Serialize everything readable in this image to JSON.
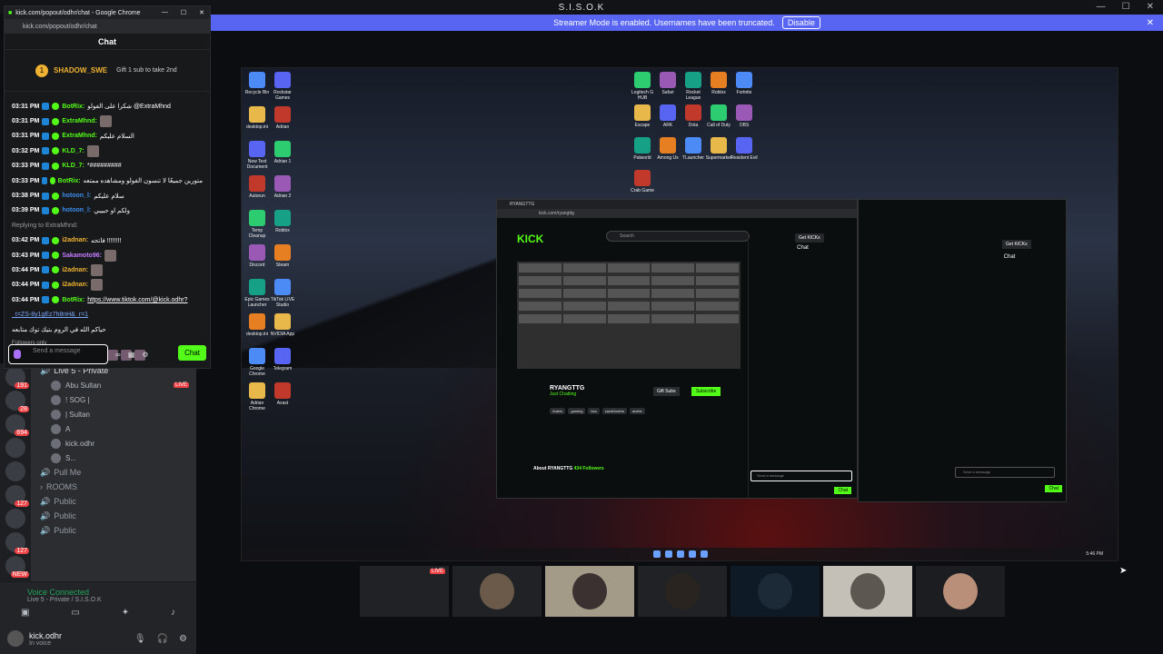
{
  "window": {
    "title": "S.I.S.O.K"
  },
  "banner": {
    "text": "Streamer Mode is enabled. Usernames have been truncated.",
    "button": "Disable"
  },
  "popout": {
    "title": "kick.com/popout/odhr/chat - Google Chrome",
    "url": "kick.com/popout/odhr/chat",
    "header": "Chat",
    "pinned_name": "SHADOW_SWE",
    "pinned_count": "1",
    "gift_text": "Gift 1 sub to take 2nd",
    "messages": [
      {
        "time": "03:31 PM",
        "user": "BotRix:",
        "color": "#53fc18",
        "text": "شكرا على الفولو @ExtraMhnd"
      },
      {
        "time": "03:31 PM",
        "user": "ExtraMhnd:",
        "color": "#53fc18",
        "text": ""
      },
      {
        "time": "03:31 PM",
        "user": "ExtraMhnd:",
        "color": "#53fc18",
        "text": "السلام عليكم"
      },
      {
        "time": "03:32 PM",
        "user": "KLD_7:",
        "color": "#53fc18",
        "text": ""
      },
      {
        "time": "03:33 PM",
        "user": "KLD_7:",
        "color": "#53fc18",
        "text": "*#########"
      },
      {
        "time": "03:33 PM",
        "user": "BotRix:",
        "color": "#53fc18",
        "text": "متورين جميعًا لا تنسون الفولو ومشاهده ممتعه"
      },
      {
        "time": "03:38 PM",
        "user": "hotoon_l:",
        "color": "#3b8eea",
        "text": "سلام عليكم"
      },
      {
        "time": "03:39 PM",
        "user": "hotoon_l:",
        "color": "#3b8eea",
        "text": "ولكم او حبيبي"
      },
      {
        "time": "03:42 PM",
        "user": "i2adnan:",
        "color": "#f0b232",
        "text": "فاتحه !!!!!!!!"
      },
      {
        "time": "03:43 PM",
        "user": "Sakamoto96:",
        "color": "#c27cff",
        "text": ""
      },
      {
        "time": "03:44 PM",
        "user": "i2adnan:",
        "color": "#f0b232",
        "text": ""
      },
      {
        "time": "03:44 PM",
        "user": "i2adnan:",
        "color": "#f0b232",
        "text": ""
      },
      {
        "time": "03:44 PM",
        "user": "BotRix:",
        "color": "#53fc18",
        "text": "https://www.tiktok.com/@kick.odhr?"
      }
    ],
    "reply_text": "Replying to ExtraMhnd:",
    "link_cont": "_t=ZS-8y1gEz7h8nH&_r=1",
    "link_note": "حياكم الله في الروم بتيك توك متابعه",
    "followers_only": "Followers only",
    "input_placeholder": "Send a message",
    "chat_button": "Chat"
  },
  "discord": {
    "channel_live": "Live 5 - Private",
    "users": [
      {
        "name": "Abu Sultan",
        "live": "LIVE"
      },
      {
        "name": "! SOG |"
      },
      {
        "name": "| Sultan"
      },
      {
        "name": "A"
      },
      {
        "name": "kick.odhr"
      },
      {
        "name": "S..."
      }
    ],
    "pull_me": "Pull Me",
    "rooms": "ROOMS",
    "publics": [
      "Public",
      "Public",
      "Public"
    ],
    "voice_connected": "Voice Connected",
    "voice_sub": "Live 5 - Private / S.I.S.O.K",
    "username": "kick.odhr",
    "status": "In voice",
    "badges": [
      "191",
      "28",
      "694",
      "127",
      "127",
      "NEW"
    ]
  },
  "browser": {
    "kick_logo": "KICK",
    "search": "Search",
    "get_kicks": "Get KICKs",
    "streamer": "RYANGTTG",
    "category": "Just Chatting",
    "tags": [
      "Arabic",
      "gaming",
      "ksa",
      "saudiArabia",
      "arabic"
    ],
    "gift_subs": "Gift Subs",
    "subscribe": "Subscribe",
    "about": "About RYANGTTG",
    "followers": "434 Followers",
    "chat": "Chat",
    "send": "Send a message",
    "chat_button": "Chat"
  },
  "taskbar": {
    "clock": "5:46 PM"
  },
  "stage": {
    "live": "LIVE"
  },
  "desktop_icons": [
    "Recycle Bin",
    "desktop.ini",
    "New Text Document",
    "Autorun",
    "Temp Cleanup",
    "Discord",
    "Epic Games Launcher",
    "desktop.ini",
    "Google Chrome",
    "Adrian Chrome",
    "Rockstar Games",
    "Adrian",
    "Adrian 1",
    "Adrian 2",
    "Roblox",
    "Steam",
    "TikTok LIVE Studio",
    "NVIDIA App",
    "Telegram",
    "Avast",
    "Logitech G HUB",
    "Safari",
    "Rocket League",
    "Roblox",
    "Fortnite",
    "Escape",
    "ARK",
    "Dota",
    "Call of Duty",
    "OBS",
    "Palworld",
    "Among Us",
    "TLauncher",
    "Supermarket",
    "Resident Evil",
    "Crab Game"
  ]
}
